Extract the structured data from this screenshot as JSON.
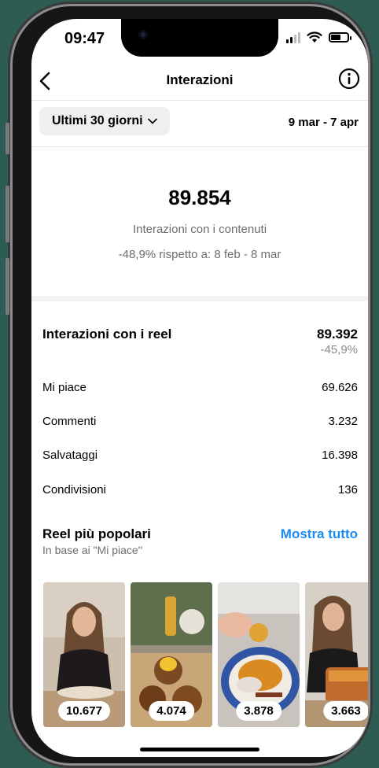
{
  "status": {
    "time": "09:47"
  },
  "nav": {
    "title": "Interazioni",
    "back_icon": "chevron-left-icon",
    "info_icon": "info-icon"
  },
  "filter": {
    "range_label": "Ultimi 30 giorni",
    "dates": "9 mar - 7 apr"
  },
  "summary": {
    "total": "89.854",
    "label": "Interazioni con i contenuti",
    "compare": "-48,9% rispetto a: 8 feb - 8 mar"
  },
  "reels": {
    "title": "Interazioni con i reel",
    "total": "89.392",
    "change": "-45,9%",
    "metrics": [
      {
        "label": "Mi piace",
        "value": "69.626"
      },
      {
        "label": "Commenti",
        "value": "3.232"
      },
      {
        "label": "Salvataggi",
        "value": "16.398"
      },
      {
        "label": "Condivisioni",
        "value": "136"
      }
    ]
  },
  "popular": {
    "title": "Reel più popolari",
    "subtitle": "In base ai \"Mi piace\"",
    "show_all": "Mostra tutto",
    "items": [
      {
        "count": "10.677"
      },
      {
        "count": "4.074"
      },
      {
        "count": "3.878"
      },
      {
        "count": "3.663"
      }
    ]
  },
  "colors": {
    "accent": "#1a8cf0",
    "muted": "#6d6d6d",
    "background": "#2e5b52"
  }
}
